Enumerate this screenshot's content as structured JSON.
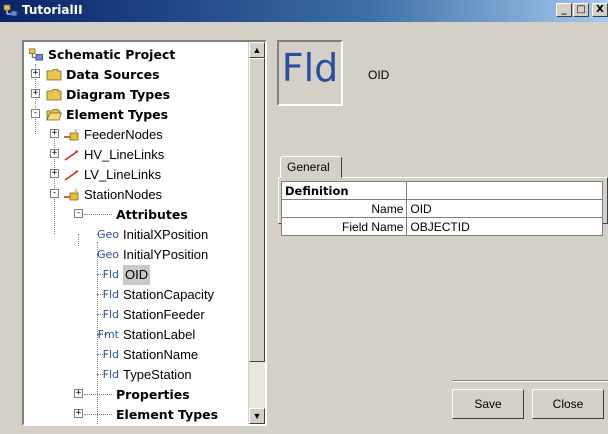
{
  "window": {
    "title": "TutorialII",
    "minimize": "_",
    "maximize": "□",
    "close": "X"
  },
  "tree": {
    "root": "Schematic Project",
    "data_sources": "Data Sources",
    "diagram_types": "Diagram Types",
    "element_types": "Element Types",
    "feeder_nodes": "FeederNodes",
    "hv_linelinks": "HV_LineLinks",
    "lv_linelinks": "LV_LineLinks",
    "station_nodes": "StationNodes",
    "attributes": "Attributes",
    "attr_items": [
      {
        "tag": "Geo",
        "label": "InitialXPosition"
      },
      {
        "tag": "Geo",
        "label": "InitialYPosition"
      },
      {
        "tag": "Fld",
        "label": "OID"
      },
      {
        "tag": "Fld",
        "label": "StationCapacity"
      },
      {
        "tag": "Fld",
        "label": "StationFeeder"
      },
      {
        "tag": "Fmt",
        "label": "StationLabel"
      },
      {
        "tag": "Fld",
        "label": "StationName"
      },
      {
        "tag": "Fld",
        "label": "TypeStation"
      }
    ],
    "properties": "Properties",
    "element_types_child": "Element Types",
    "expand_plus": "+",
    "expand_minus": "-"
  },
  "detail": {
    "icon_text": "Fld",
    "header_name": "OID",
    "tab_general": "General",
    "table": {
      "section": "Definition",
      "rows": [
        {
          "key": "Name",
          "value": "OID"
        },
        {
          "key": "Field Name",
          "value": "OBJECTID"
        }
      ]
    }
  },
  "buttons": {
    "save": "Save",
    "close": "Close"
  },
  "colors": {
    "titlebar": "#0a246a",
    "dialog_bg": "#d4d0c8",
    "icon_blue": "#2a4ea0",
    "folder_yellow": "#e8c84c"
  }
}
